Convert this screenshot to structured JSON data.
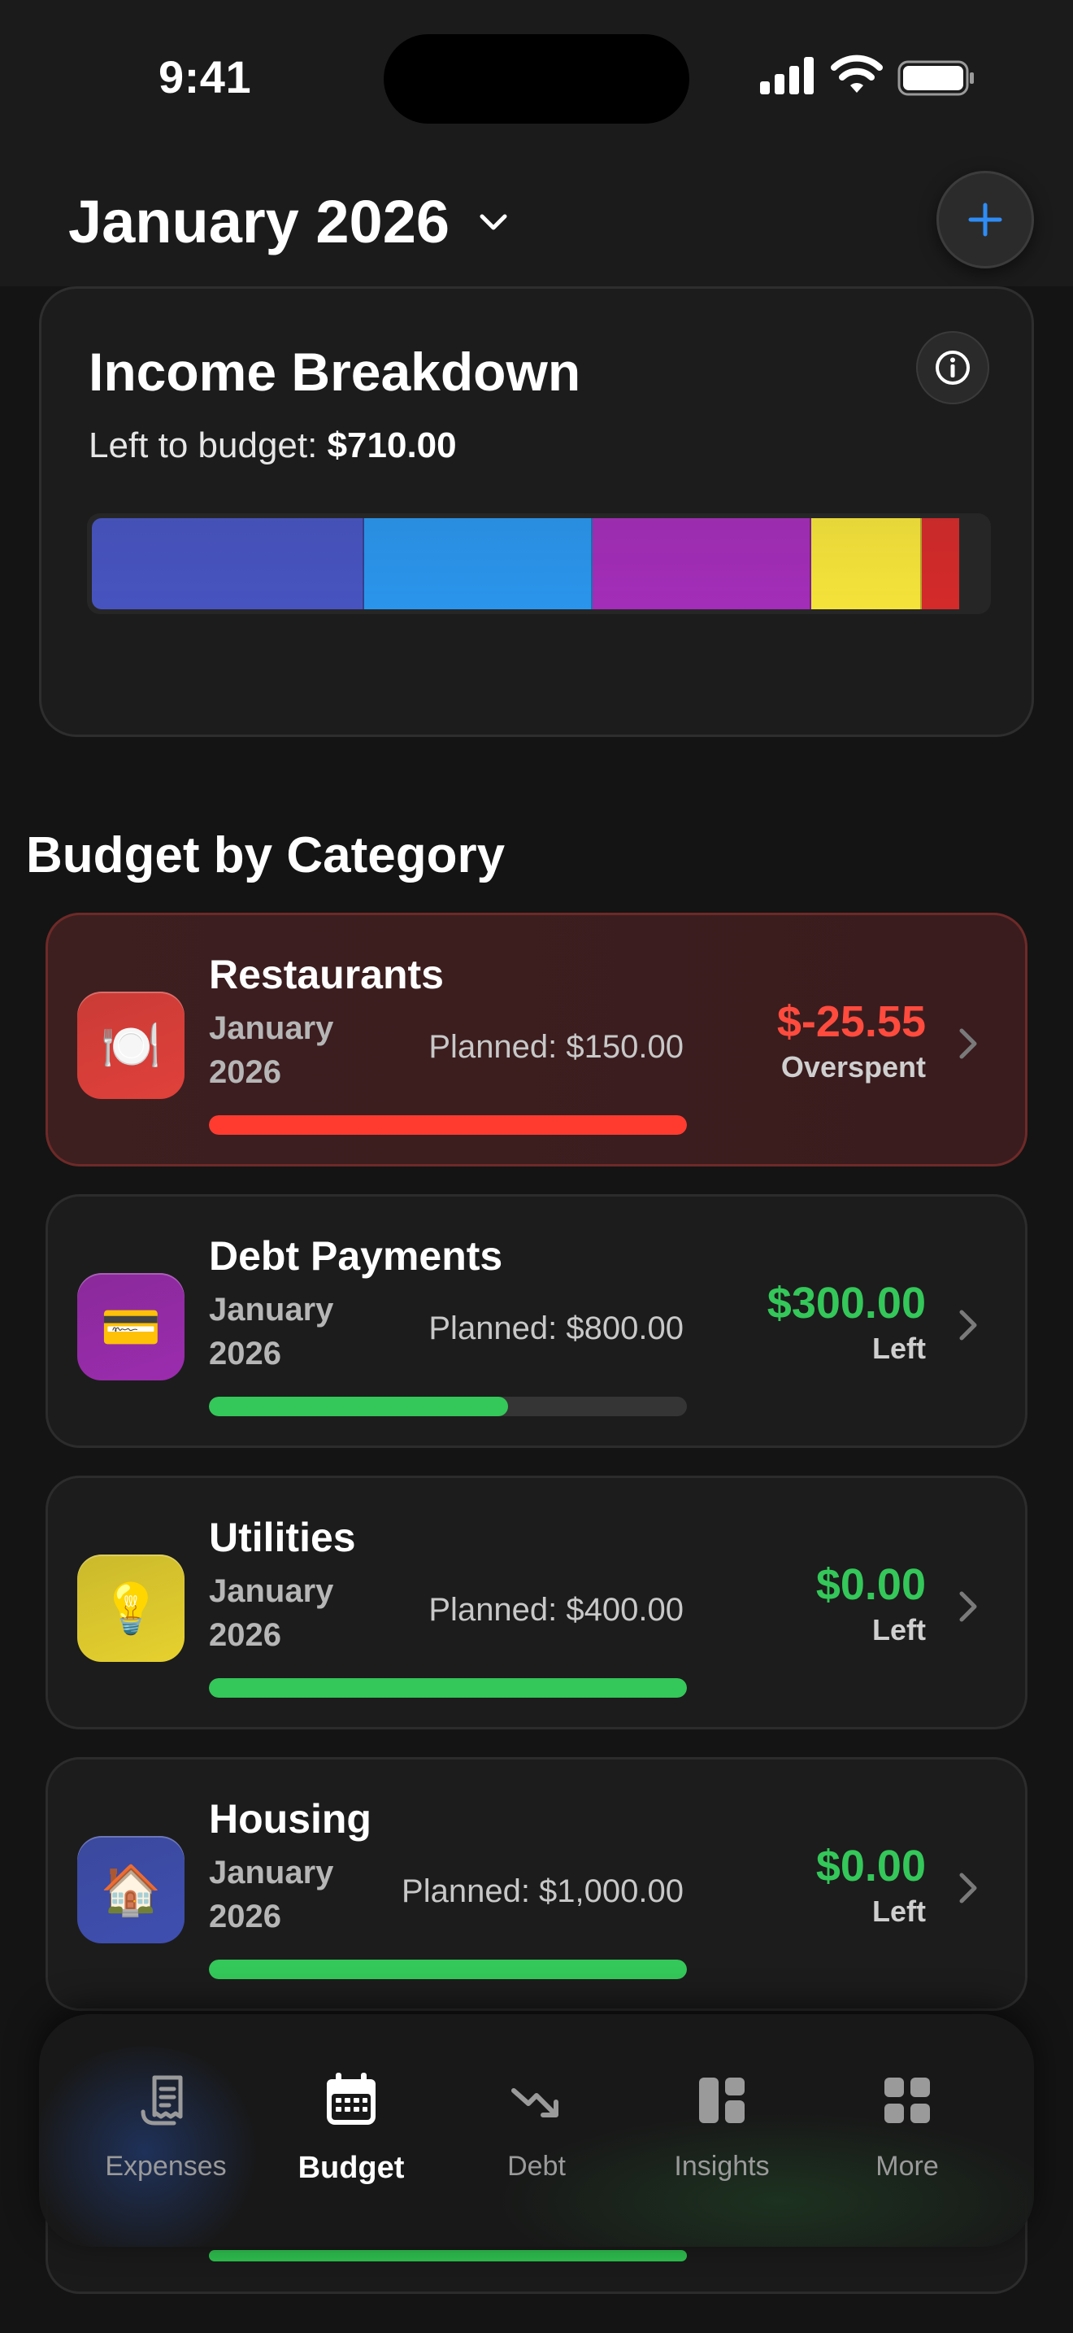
{
  "status_bar": {
    "time": "9:41"
  },
  "header": {
    "title": "January 2026"
  },
  "income": {
    "title": "Income Breakdown",
    "left_label": "Left to budget:",
    "left_value": "$710.00",
    "segments": [
      {
        "color": "#4754c0",
        "fraction": 0.305
      },
      {
        "color": "#2a95ec",
        "fraction": 0.255
      },
      {
        "color": "#a32db8",
        "fraction": 0.245
      },
      {
        "color": "#f5e33a",
        "fraction": 0.123
      },
      {
        "color": "#d42a2a",
        "fraction": 0.042
      }
    ]
  },
  "section_title": "Budget by Category",
  "categories": [
    {
      "name": "Restaurants",
      "date": "January 2026",
      "planned": "Planned: $150.00",
      "amount": "$-25.55",
      "status": "Overspent",
      "icon": "🍽️",
      "icon_name": "plate-cutlery-icon",
      "icon_bg": "#e0403a",
      "amount_color": "#ff4b3e",
      "bar_color": "#ff3b30",
      "progress": 1.0,
      "overspent": true
    },
    {
      "name": "Debt Payments",
      "date": "January 2026",
      "planned": "Planned: $800.00",
      "amount": "$300.00",
      "status": "Left",
      "icon": "💳",
      "icon_name": "credit-card-icon",
      "icon_bg": "#9b2cae",
      "amount_color": "#34c759",
      "bar_color": "#34c759",
      "progress": 0.625,
      "overspent": false
    },
    {
      "name": "Utilities",
      "date": "January 2026",
      "planned": "Planned: $400.00",
      "amount": "$0.00",
      "status": "Left",
      "icon": "💡",
      "icon_name": "lightbulb-icon",
      "icon_bg": "#e6d12e",
      "amount_color": "#34c759",
      "bar_color": "#34c759",
      "progress": 1.0,
      "overspent": false
    },
    {
      "name": "Housing",
      "date": "January 2026",
      "planned": "Planned: $1,000.00",
      "amount": "$0.00",
      "status": "Left",
      "icon": "🏠",
      "icon_name": "house-icon",
      "icon_bg": "#3f4fb0",
      "amount_color": "#34c759",
      "bar_color": "#34c759",
      "progress": 1.0,
      "overspent": false
    }
  ],
  "tabs": [
    {
      "label": "Expenses",
      "icon": "receipt-icon",
      "active": false
    },
    {
      "label": "Budget",
      "icon": "calendar-icon",
      "active": true
    },
    {
      "label": "Debt",
      "icon": "trend-down-icon",
      "active": false
    },
    {
      "label": "Insights",
      "icon": "dashboard-icon",
      "active": false
    },
    {
      "label": "More",
      "icon": "grid-icon",
      "active": false
    }
  ]
}
